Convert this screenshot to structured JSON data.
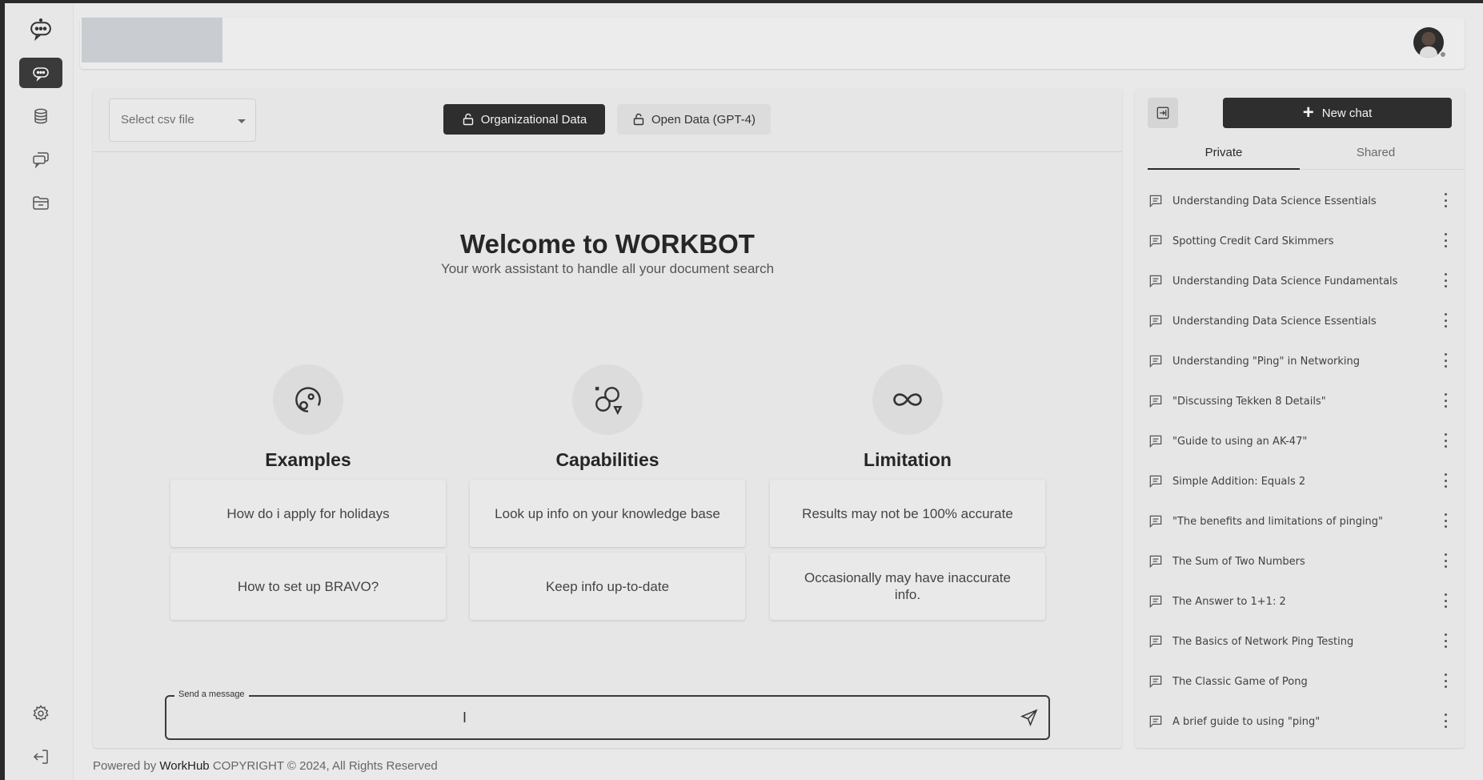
{
  "header": {
    "avatar_alt": "User avatar"
  },
  "rail": {
    "items": [
      {
        "icon": "chatbot-logo-icon"
      },
      {
        "icon": "chat-icon",
        "active": true
      },
      {
        "icon": "database-icon"
      },
      {
        "icon": "conversations-icon"
      },
      {
        "icon": "folder-icon"
      },
      {
        "icon": "settings-icon"
      },
      {
        "icon": "logout-icon"
      }
    ]
  },
  "toolbar": {
    "csv_placeholder": "Select csv file",
    "org_data_label": "Organizational Data",
    "open_data_label": "Open Data (GPT-4)"
  },
  "welcome": {
    "title": "Welcome to WORKBOT",
    "subtitle": "Your work assistant to handle all your document search"
  },
  "columns": [
    {
      "title": "Examples",
      "icon": "examples-icon",
      "cards": [
        "How do i apply for holidays",
        "How to set up BRAVO?"
      ]
    },
    {
      "title": "Capabilities",
      "icon": "capabilities-icon",
      "cards": [
        "Look up info on your knowledge base",
        "Keep info up-to-date"
      ]
    },
    {
      "title": "Limitation",
      "icon": "infinity-icon",
      "cards": [
        "Results may not be 100% accurate",
        "Occasionally may have inaccurate info."
      ]
    }
  ],
  "composer": {
    "label": "Send a message",
    "value": "",
    "cursor_glyph": "I"
  },
  "footer": {
    "powered_by": "Powered by",
    "brand": "WorkHub",
    "copyright": "COPYRIGHT © 2024, All Rights Reserved"
  },
  "sidebar": {
    "new_chat_label": "New chat",
    "tabs": [
      {
        "label": "Private",
        "active": true
      },
      {
        "label": "Shared",
        "active": false
      }
    ],
    "chats": [
      "Understanding Data Science Essentials",
      "Spotting Credit Card Skimmers",
      "Understanding Data Science Fundamentals",
      "Understanding Data Science Essentials",
      "Understanding \"Ping\" in Networking",
      "\"Discussing Tekken 8 Details\"",
      "\"Guide to using an AK-47\"",
      "Simple Addition: Equals 2",
      "\"The benefits and limitations of pinging\"",
      "The Sum of Two Numbers",
      "The Answer to 1+1: 2",
      "The Basics of Network Ping Testing",
      "The Classic Game of Pong",
      "A brief guide to using \"ping\""
    ]
  },
  "colors": {
    "accent_dark": "#2e2e2e",
    "background": "#e9e9e9",
    "panel": "#e6e6e6"
  }
}
